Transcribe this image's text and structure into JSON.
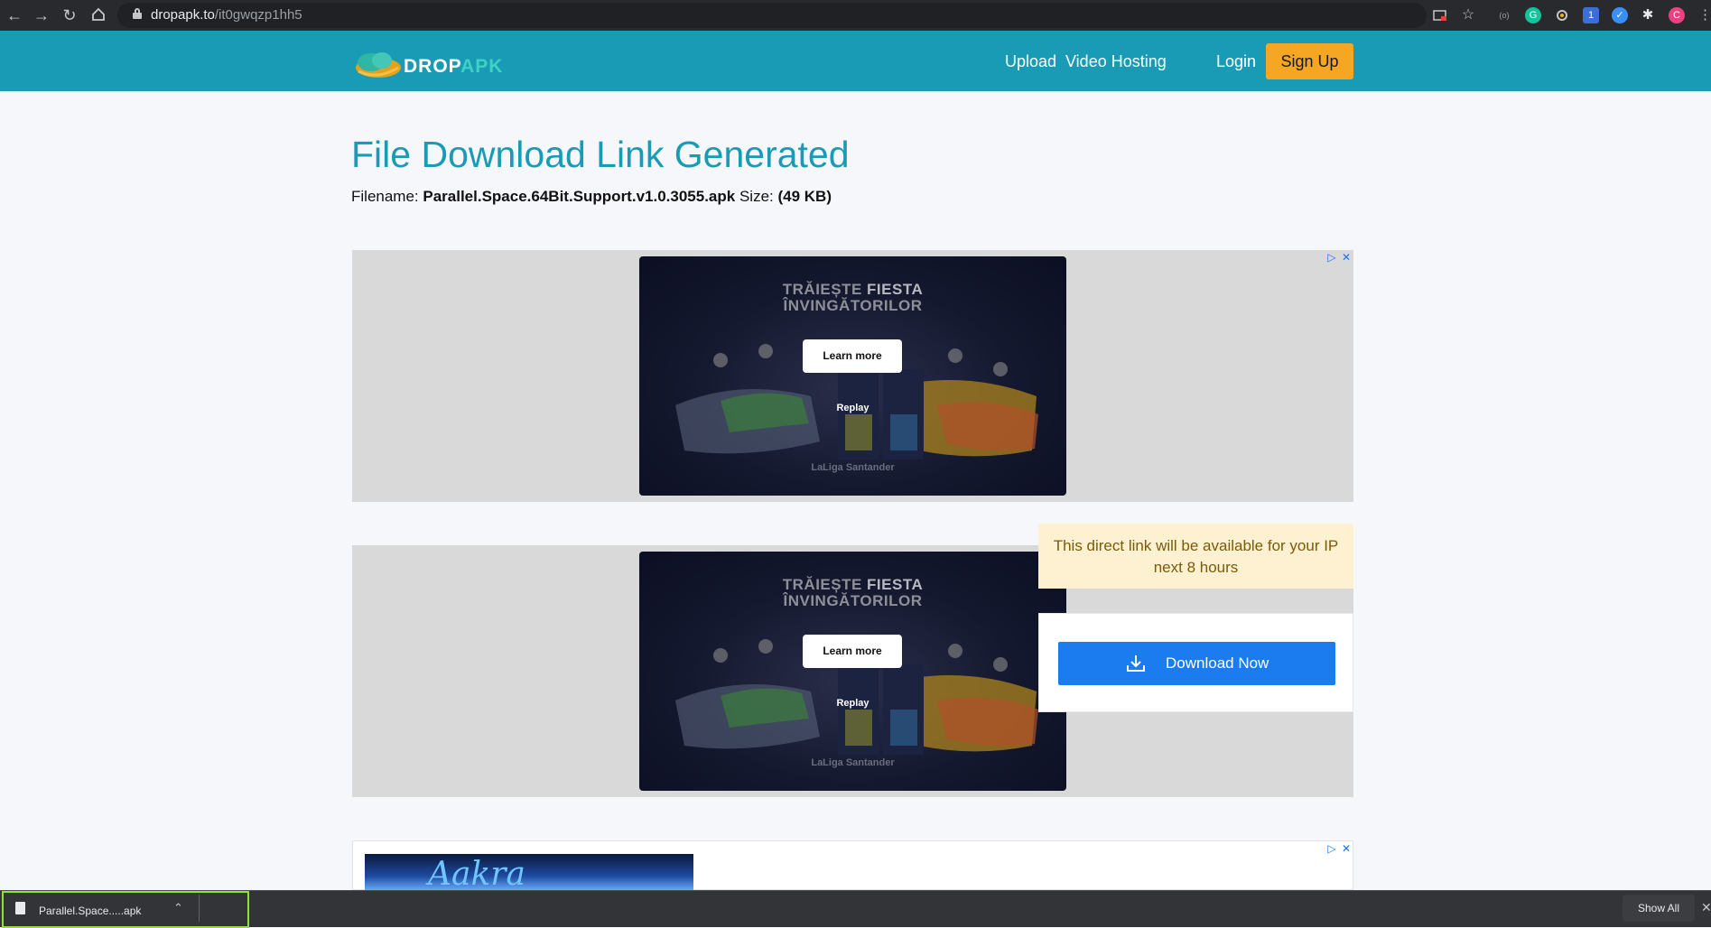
{
  "browser": {
    "url_domain": "dropapk.to",
    "url_path": "/it0gwqzp1hh5"
  },
  "header": {
    "logo_word1": "DROP",
    "logo_word2": "APK",
    "nav": {
      "upload": "Upload",
      "video_hosting": "Video Hosting",
      "login": "Login",
      "signup": "Sign Up"
    }
  },
  "main": {
    "title": "File Download Link Generated",
    "filename_label": "Filename:",
    "filename": "Parallel.Space.64Bit.Support.v1.0.3055.apk",
    "size_label": "Size:",
    "size": "(49 KB)"
  },
  "ads": {
    "headline_line1_a": "TRĂIEȘTE ",
    "headline_line1_b": "FIESTA",
    "headline_line2": "ÎNVINGĂTORILOR",
    "learn_more": "Learn more",
    "replay": "Replay",
    "brand": "LaLiga  Santander",
    "ad3_text": "Aakra"
  },
  "download": {
    "notice": "This direct link will be available for your IP next 8 hours",
    "button": "Download Now"
  },
  "shelf": {
    "file": "Parallel.Space.....apk",
    "show_all": "Show All"
  },
  "colors": {
    "header_bg": "#1a9bb5",
    "signup_bg": "#f5a623",
    "download_btn": "#1b7cf0",
    "notice_bg": "#fdf1d2"
  }
}
